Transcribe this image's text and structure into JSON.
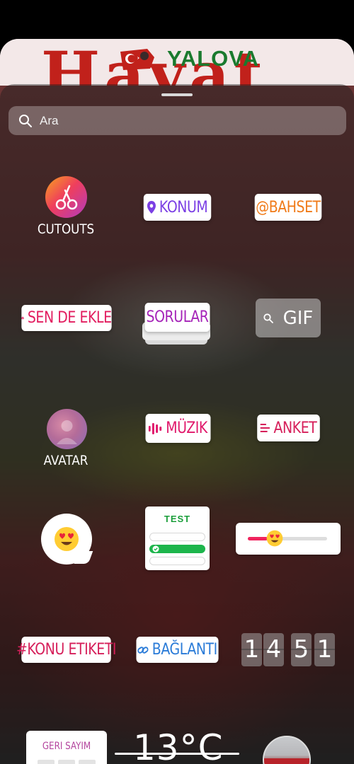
{
  "background": {
    "masthead_main": "Hayat",
    "masthead_sub": "YALOVA"
  },
  "search": {
    "placeholder": "Ara"
  },
  "stickers": {
    "cutouts": "CUTOUTS",
    "location": "KONUM",
    "mention": "@BAHSET",
    "add_yours": "SEN DE EKLE",
    "questions": "SORULAR",
    "gif": "GIF",
    "avatar": "AVATAR",
    "music": "MÜZIK",
    "poll": "ANKET",
    "quiz_title": "TEST",
    "hashtag": "#KONU ETIKETI",
    "link": "BAĞLANTI",
    "time_digits": [
      "1",
      "4",
      "5",
      "1"
    ],
    "countdown": "GERI SAYIM",
    "temperature": "13°C"
  },
  "quiz": {
    "options_count_note": "",
    "selected_index": 1
  },
  "emoji_slider": {
    "value": 0.25
  },
  "colors": {
    "location_purple": "#7b3fe4",
    "mention_orange": "#f07a18",
    "add_yours_pink": "#e21c5f",
    "questions_purple": "#a523b8",
    "music_pink": "#e0176a",
    "hashtag_pink": "#d61f5a",
    "link_blue": "#2a7bd8",
    "quiz_green": "#1db54c"
  }
}
